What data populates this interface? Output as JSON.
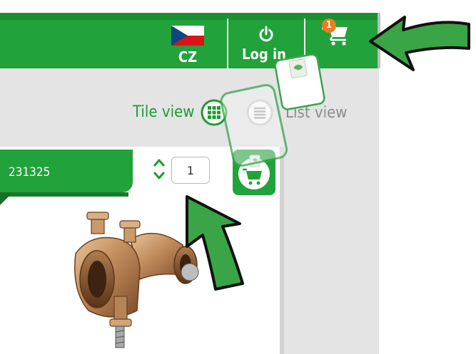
{
  "header": {
    "language": {
      "label": "CZ",
      "flag": "czech-flag"
    },
    "login": {
      "label": "Log in",
      "icon": "power-icon"
    },
    "cart": {
      "count": "1",
      "icon": "cart-icon"
    }
  },
  "view_toggle": {
    "tile_label": "Tile view",
    "list_label": "List view"
  },
  "product": {
    "code": "231325",
    "quantity": "1",
    "image": "bronze-pipe-clamp"
  },
  "colors": {
    "brand_green": "#21a23a",
    "dark_green": "#1b9032",
    "badge_orange": "#f07b1f",
    "list_grey": "#8c8c8c",
    "panel_grey": "#e4e4e4"
  }
}
